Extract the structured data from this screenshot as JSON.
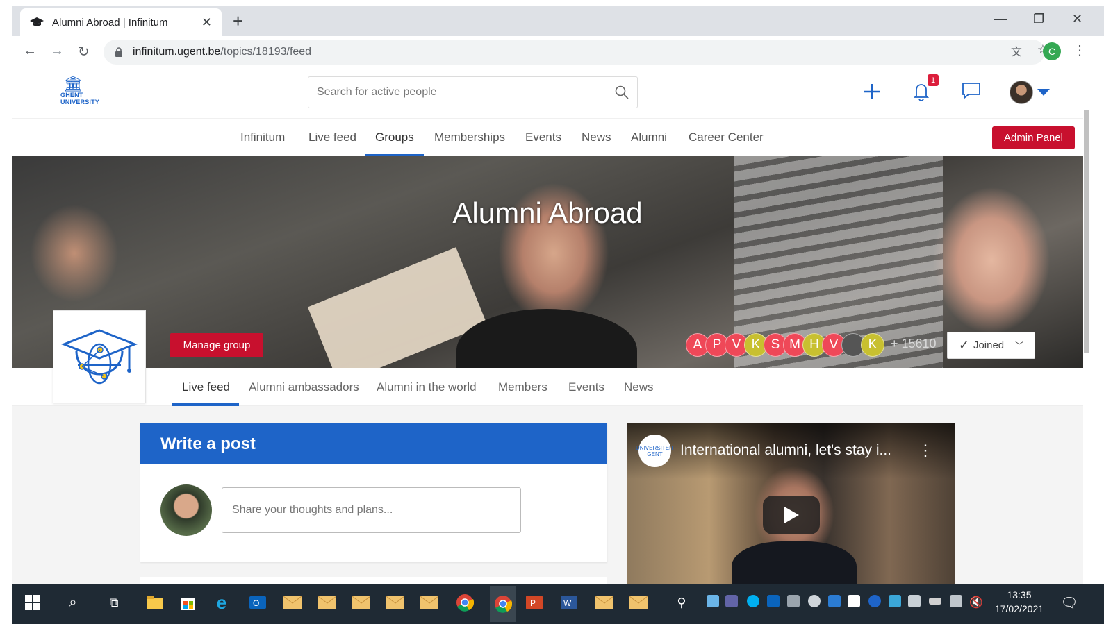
{
  "browser": {
    "tab_title": "Alumni Abroad | Infinitum",
    "tab_close": "✕",
    "new_tab": "+",
    "url_host": "infinitum.ugent.be",
    "url_path": "/topics/18193/feed",
    "profile_initial": "C"
  },
  "header": {
    "logo_line1": "GHENT",
    "logo_line2": "UNIVERSITY",
    "search_placeholder": "Search for active people",
    "notification_count": "1"
  },
  "main_nav": {
    "items": [
      "Infinitum",
      "Live feed",
      "Groups",
      "Memberships",
      "Events",
      "News",
      "Alumni",
      "Career Center"
    ],
    "active": "Groups",
    "admin_label": "Admin Panel"
  },
  "hero": {
    "title": "Alumni Abroad",
    "manage_label": "Manage group",
    "member_initials": [
      "A",
      "P",
      "V",
      "K",
      "S",
      "M",
      "H",
      "V",
      "",
      "K"
    ],
    "member_colors": [
      "#ef4858",
      "#ef4858",
      "#ef4858",
      "#c8c030",
      "#ef4858",
      "#ef4858",
      "#c8c030",
      "#ef4858",
      "#555555",
      "#c8c030"
    ],
    "member_count": "+ 15610",
    "joined_label": "Joined"
  },
  "sub_nav": {
    "items": [
      "Live feed",
      "Alumni ambassadors",
      "Alumni in the world",
      "Members",
      "Events",
      "News"
    ],
    "active": "Live feed"
  },
  "post": {
    "heading": "Write a post",
    "placeholder": "Share your thoughts and plans..."
  },
  "video": {
    "title": "International alumni, let's stay i...",
    "channel_logo_text": "UNIVERSITEIT GENT"
  },
  "taskbar": {
    "time": "13:35",
    "date": "17/02/2021"
  },
  "colors": {
    "brand_blue": "#1e64c8",
    "brand_red": "#c8102e",
    "taskbar": "#1f2a34"
  }
}
